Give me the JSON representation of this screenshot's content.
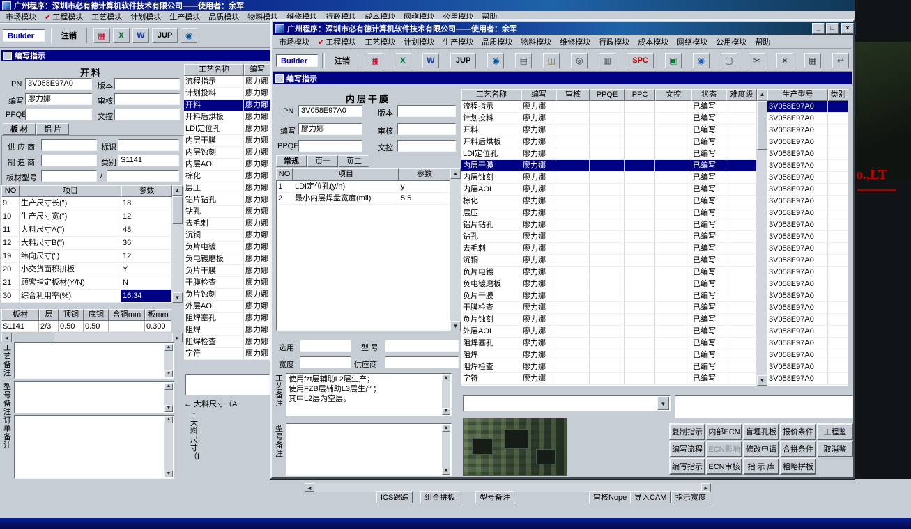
{
  "window_title": "广州程序：深圳市必有德计算机软件技术有限公司——使用者：余军",
  "menu_items": [
    "市场模块",
    "工程模块",
    "工艺模块",
    "计划模块",
    "生产模块",
    "品质模块",
    "物料模块",
    "维修模块",
    "行政模块",
    "成本模块",
    "网络模块",
    "公用模块",
    "帮助"
  ],
  "checked_menu": "工程模块",
  "check_glyph": "✔",
  "panel_title": "编写指示",
  "toolbar": {
    "builder": "Builder",
    "logout": "注销"
  },
  "toolbar_icons": {
    "bg": [
      {
        "name": "module-grid-icon",
        "glyph": "▦",
        "color": "#b00020"
      },
      {
        "name": "excel-icon",
        "glyph": "X",
        "color": "#0a7a3c"
      },
      {
        "name": "word-icon",
        "glyph": "W",
        "color": "#1a3f9e"
      },
      {
        "name": "jup-button",
        "glyph": "JUP",
        "color": "#000000",
        "wide": true
      },
      {
        "name": "preview-eye-icon",
        "glyph": "◉",
        "color": "#00589e"
      }
    ],
    "fg": [
      {
        "name": "module-grid-icon",
        "glyph": "▦",
        "color": "#b00020"
      },
      {
        "name": "excel-icon",
        "glyph": "X",
        "color": "#0a7a3c"
      },
      {
        "name": "word-icon",
        "glyph": "W",
        "color": "#1a3f9e"
      },
      {
        "name": "jup-button",
        "glyph": "JUP",
        "color": "#000000",
        "wide": true
      },
      {
        "name": "preview-eye-icon",
        "glyph": "◉",
        "color": "#00589e"
      },
      {
        "name": "printer-icon",
        "glyph": "▤",
        "color": "#444b52"
      },
      {
        "name": "database-icon",
        "glyph": "◫",
        "color": "#8a6d00"
      },
      {
        "name": "users-icon",
        "glyph": "◎",
        "color": "#333a44"
      },
      {
        "name": "report-print-icon",
        "glyph": "▥",
        "color": "#444b52"
      },
      {
        "name": "spc-button",
        "glyph": "SPC",
        "color": "#c00000",
        "wide": true
      },
      {
        "name": "chart-icon",
        "glyph": "▣",
        "color": "#0a7a3c"
      },
      {
        "name": "globe-icon",
        "glyph": "◉",
        "color": "#2060c0"
      },
      {
        "name": "new-doc-icon",
        "glyph": "▢",
        "color": "#333333"
      },
      {
        "name": "cut-icon",
        "glyph": "✂",
        "color": "#333333"
      },
      {
        "name": "delete-icon",
        "glyph": "×",
        "color": "#333333"
      },
      {
        "name": "save-icon",
        "glyph": "▦",
        "color": "#333333"
      },
      {
        "name": "undo-icon",
        "glyph": "↩",
        "color": "#333333"
      }
    ]
  },
  "field_labels": {
    "pn": "PN",
    "version": "版本",
    "writer": "编写",
    "audit": "审核",
    "ppqe": "PPQE",
    "doc": "文控"
  },
  "product_model": "3V058E97A0",
  "writer": "廖力娜",
  "status_written": "已编写",
  "processes": [
    "流程指示",
    "计划投料",
    "开料",
    "开料后烘板",
    "LDI定位孔",
    "内层干膜",
    "内层蚀刻",
    "内层AOI",
    "棕化",
    "层压",
    "铝片钻孔",
    "钻孔",
    "去毛刺",
    "沉铜",
    "负片电镀",
    "负电镀磨板",
    "负片干膜",
    "干膜检查",
    "负片蚀刻",
    "外层AOI",
    "阻焊塞孔",
    "阻焊",
    "阻焊检查",
    "字符"
  ],
  "bg_window": {
    "form_title": "开料",
    "tabs": [
      "板 材",
      "铝 片"
    ],
    "supplier_label": "供 应 商",
    "mark_label": "标识",
    "maker_label": "制 造 商",
    "category_label": "类别",
    "category_value": "S1141",
    "board_model_label": "板材型号",
    "slash": "/",
    "param_headers": [
      "NO",
      "项目",
      "参数"
    ],
    "param_rows": [
      [
        "9",
        "生产尺寸长(\")",
        "18"
      ],
      [
        "10",
        "生产尺寸宽(\")",
        "12"
      ],
      [
        "11",
        "大料尺寸A(\")",
        "48"
      ],
      [
        "12",
        "大料尺寸B(\")",
        "36"
      ],
      [
        "19",
        "纬向尺寸(\")",
        "12"
      ],
      [
        "20",
        "小交货面积拼板",
        "Y"
      ],
      [
        "21",
        "顾客指定板材(Y/N)",
        "N"
      ],
      [
        "30",
        "综合利用率(%)",
        "16.34"
      ]
    ],
    "selected_param_no": "30",
    "board_headers": [
      "板材",
      "层",
      "顶铜",
      "底铜",
      "含铜mm",
      "板mm"
    ],
    "board_row": [
      "S1141",
      "2/3",
      "0.50",
      "0.50",
      "",
      "0.300"
    ],
    "note_labels": [
      "工艺备注",
      "型号备注",
      "订单备注"
    ],
    "list_headers": [
      "工艺名称",
      "编写"
    ],
    "selected_process": "开料",
    "size_a": "←  大料尺寸（A",
    "size_b": "↑大料尺寸（B）",
    "bottom_buttons": [
      "ICS跟踪",
      "组合拼板",
      "型号备注",
      "审核Nope",
      "导入CAM",
      "指示宽度"
    ]
  },
  "fg_window": {
    "form_title": "内层干膜",
    "caption_buttons": [
      "_",
      "□",
      "×"
    ],
    "labels": {
      "select": "选用",
      "model": "型 号",
      "width": "宽度",
      "supplier": "供应商"
    },
    "tabs": [
      "常规",
      "页一",
      "页二"
    ],
    "param_headers": [
      "NO",
      "项目",
      "参数"
    ],
    "param_rows": [
      [
        "1",
        "LDI定位孔(y/n)",
        "y"
      ],
      [
        "2",
        "最小内层焊盘宽度(mil)",
        "5.5"
      ]
    ],
    "craft_note_label": "工艺备注",
    "craft_note": "使用fzt层辅助L2层生产；\n使用FZB层辅助L3层生产；\n其中L2层为空层。",
    "model_note_label": "型号备注",
    "table_headers": [
      "工艺名称",
      "编写",
      "审核",
      "PPQE",
      "PPC",
      "文控",
      "状态",
      "难度级"
    ],
    "model_headers": [
      "生产型号",
      "类别"
    ],
    "selected_process": "内层干膜",
    "action_buttons": [
      [
        "复制指示",
        "内部ECN",
        "盲埋孔板",
        "报价条件",
        "工程鉴"
      ],
      [
        "编写流程",
        "ECN影响",
        "修改申请",
        "合拼条件",
        "取消鉴"
      ],
      [
        "编写指示",
        "ECN审核",
        "指 示 库",
        "粗略拼板",
        ""
      ]
    ],
    "disabled_buttons": [
      "ECN影响"
    ]
  },
  "wallpaper_text": "o.,LT"
}
